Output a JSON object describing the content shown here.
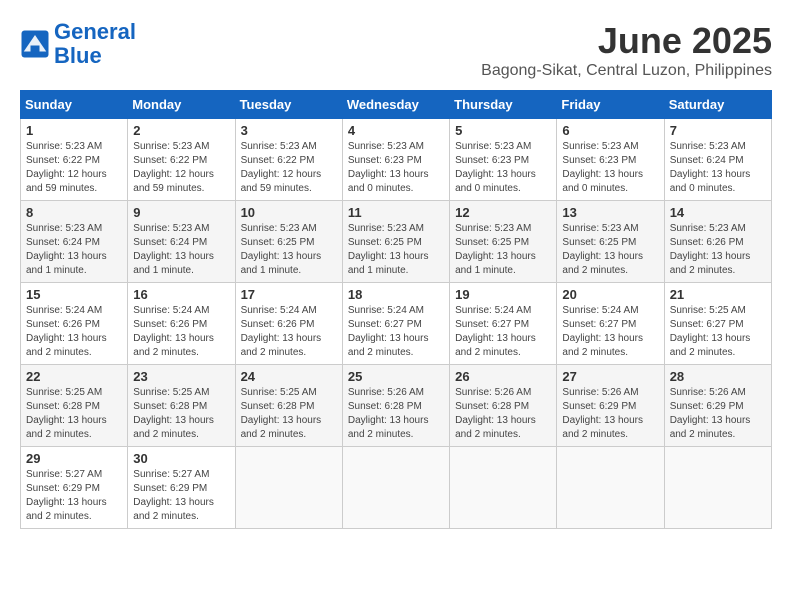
{
  "header": {
    "logo_line1": "General",
    "logo_line2": "Blue",
    "month_title": "June 2025",
    "location": "Bagong-Sikat, Central Luzon, Philippines"
  },
  "days_of_week": [
    "Sunday",
    "Monday",
    "Tuesday",
    "Wednesday",
    "Thursday",
    "Friday",
    "Saturday"
  ],
  "weeks": [
    [
      {
        "day": "1",
        "sunrise": "5:23 AM",
        "sunset": "6:22 PM",
        "daylight": "12 hours and 59 minutes."
      },
      {
        "day": "2",
        "sunrise": "5:23 AM",
        "sunset": "6:22 PM",
        "daylight": "12 hours and 59 minutes."
      },
      {
        "day": "3",
        "sunrise": "5:23 AM",
        "sunset": "6:22 PM",
        "daylight": "12 hours and 59 minutes."
      },
      {
        "day": "4",
        "sunrise": "5:23 AM",
        "sunset": "6:23 PM",
        "daylight": "13 hours and 0 minutes."
      },
      {
        "day": "5",
        "sunrise": "5:23 AM",
        "sunset": "6:23 PM",
        "daylight": "13 hours and 0 minutes."
      },
      {
        "day": "6",
        "sunrise": "5:23 AM",
        "sunset": "6:23 PM",
        "daylight": "13 hours and 0 minutes."
      },
      {
        "day": "7",
        "sunrise": "5:23 AM",
        "sunset": "6:24 PM",
        "daylight": "13 hours and 0 minutes."
      }
    ],
    [
      {
        "day": "8",
        "sunrise": "5:23 AM",
        "sunset": "6:24 PM",
        "daylight": "13 hours and 1 minute."
      },
      {
        "day": "9",
        "sunrise": "5:23 AM",
        "sunset": "6:24 PM",
        "daylight": "13 hours and 1 minute."
      },
      {
        "day": "10",
        "sunrise": "5:23 AM",
        "sunset": "6:25 PM",
        "daylight": "13 hours and 1 minute."
      },
      {
        "day": "11",
        "sunrise": "5:23 AM",
        "sunset": "6:25 PM",
        "daylight": "13 hours and 1 minute."
      },
      {
        "day": "12",
        "sunrise": "5:23 AM",
        "sunset": "6:25 PM",
        "daylight": "13 hours and 1 minute."
      },
      {
        "day": "13",
        "sunrise": "5:23 AM",
        "sunset": "6:25 PM",
        "daylight": "13 hours and 2 minutes."
      },
      {
        "day": "14",
        "sunrise": "5:23 AM",
        "sunset": "6:26 PM",
        "daylight": "13 hours and 2 minutes."
      }
    ],
    [
      {
        "day": "15",
        "sunrise": "5:24 AM",
        "sunset": "6:26 PM",
        "daylight": "13 hours and 2 minutes."
      },
      {
        "day": "16",
        "sunrise": "5:24 AM",
        "sunset": "6:26 PM",
        "daylight": "13 hours and 2 minutes."
      },
      {
        "day": "17",
        "sunrise": "5:24 AM",
        "sunset": "6:26 PM",
        "daylight": "13 hours and 2 minutes."
      },
      {
        "day": "18",
        "sunrise": "5:24 AM",
        "sunset": "6:27 PM",
        "daylight": "13 hours and 2 minutes."
      },
      {
        "day": "19",
        "sunrise": "5:24 AM",
        "sunset": "6:27 PM",
        "daylight": "13 hours and 2 minutes."
      },
      {
        "day": "20",
        "sunrise": "5:24 AM",
        "sunset": "6:27 PM",
        "daylight": "13 hours and 2 minutes."
      },
      {
        "day": "21",
        "sunrise": "5:25 AM",
        "sunset": "6:27 PM",
        "daylight": "13 hours and 2 minutes."
      }
    ],
    [
      {
        "day": "22",
        "sunrise": "5:25 AM",
        "sunset": "6:28 PM",
        "daylight": "13 hours and 2 minutes."
      },
      {
        "day": "23",
        "sunrise": "5:25 AM",
        "sunset": "6:28 PM",
        "daylight": "13 hours and 2 minutes."
      },
      {
        "day": "24",
        "sunrise": "5:25 AM",
        "sunset": "6:28 PM",
        "daylight": "13 hours and 2 minutes."
      },
      {
        "day": "25",
        "sunrise": "5:26 AM",
        "sunset": "6:28 PM",
        "daylight": "13 hours and 2 minutes."
      },
      {
        "day": "26",
        "sunrise": "5:26 AM",
        "sunset": "6:28 PM",
        "daylight": "13 hours and 2 minutes."
      },
      {
        "day": "27",
        "sunrise": "5:26 AM",
        "sunset": "6:29 PM",
        "daylight": "13 hours and 2 minutes."
      },
      {
        "day": "28",
        "sunrise": "5:26 AM",
        "sunset": "6:29 PM",
        "daylight": "13 hours and 2 minutes."
      }
    ],
    [
      {
        "day": "29",
        "sunrise": "5:27 AM",
        "sunset": "6:29 PM",
        "daylight": "13 hours and 2 minutes."
      },
      {
        "day": "30",
        "sunrise": "5:27 AM",
        "sunset": "6:29 PM",
        "daylight": "13 hours and 2 minutes."
      },
      null,
      null,
      null,
      null,
      null
    ]
  ]
}
